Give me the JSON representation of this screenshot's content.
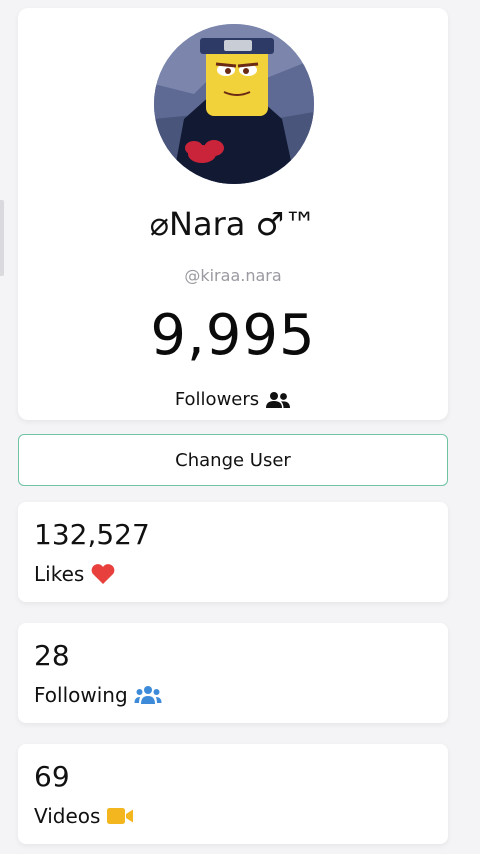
{
  "profile": {
    "display_name": "⌀Nara ♂™",
    "username": "@kiraa.nara",
    "followers_count": "9,995",
    "followers_label": "Followers"
  },
  "actions": {
    "change_user_label": "Change User"
  },
  "stats": [
    {
      "value": "132,527",
      "label": "Likes",
      "icon": "heart-icon",
      "icon_color": "#e8403c"
    },
    {
      "value": "28",
      "label": "Following",
      "icon": "users-icon",
      "icon_color": "#3d8bd8"
    },
    {
      "value": "69",
      "label": "Videos",
      "icon": "video-camera-icon",
      "icon_color": "#f3b61f"
    }
  ],
  "colors": {
    "accent_border": "#6fc3a3",
    "muted_text": "#9a9aa1"
  }
}
